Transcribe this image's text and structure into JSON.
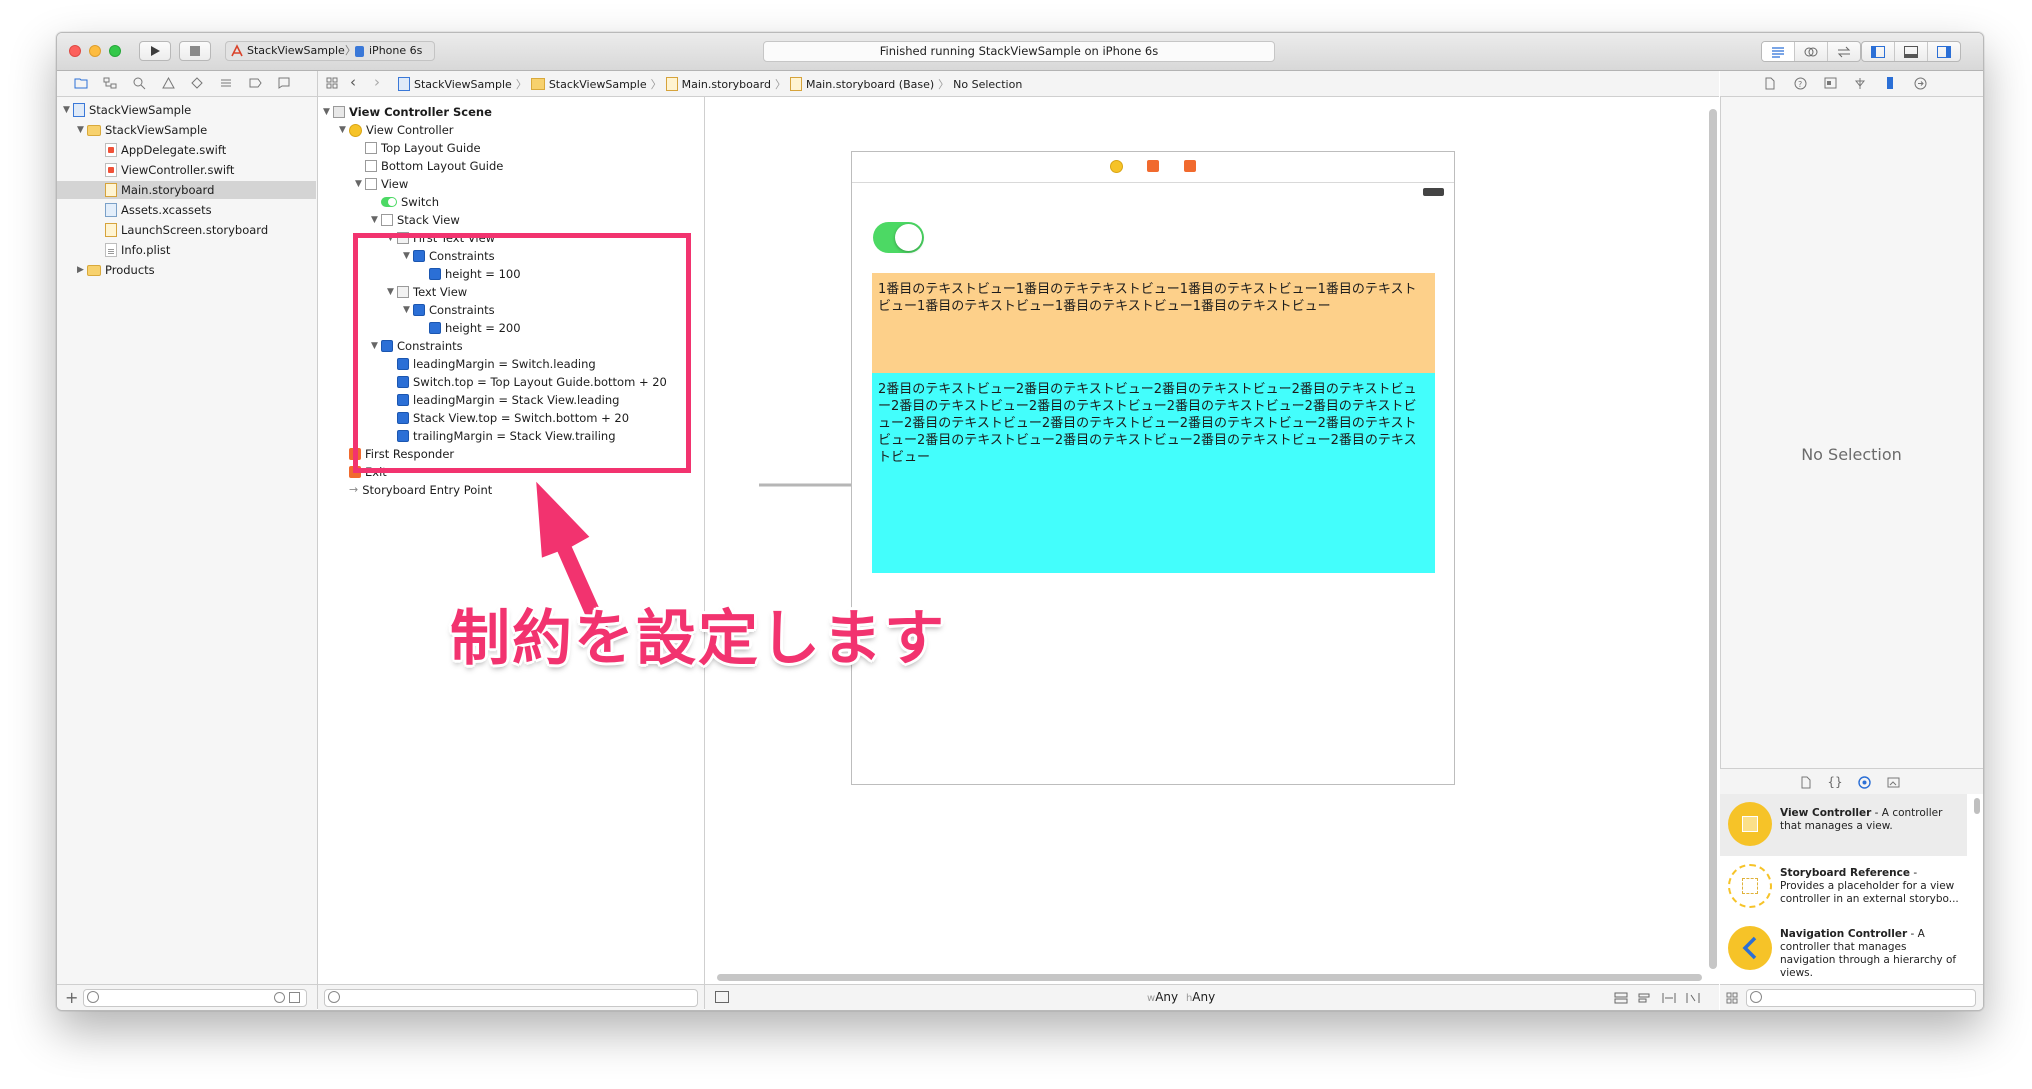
{
  "toolbar": {
    "scheme": "StackViewSample",
    "device": "iPhone 6s",
    "status": "Finished running StackViewSample on iPhone 6s",
    "colors": {
      "close": "#fc605c",
      "minimize": "#fdbc40",
      "zoom": "#34c84a"
    }
  },
  "navigator": {
    "items": [
      {
        "label": "StackViewSample"
      },
      {
        "label": "StackViewSample"
      },
      {
        "label": "AppDelegate.swift"
      },
      {
        "label": "ViewController.swift"
      },
      {
        "label": "Main.storyboard"
      },
      {
        "label": "Assets.xcassets"
      },
      {
        "label": "LaunchScreen.storyboard"
      },
      {
        "label": "Info.plist"
      },
      {
        "label": "Products"
      }
    ]
  },
  "breadcrumb": {
    "items": [
      "StackViewSample",
      "StackViewSample",
      "Main.storyboard",
      "Main.storyboard (Base)",
      "No Selection"
    ]
  },
  "outline": {
    "items": [
      {
        "label": "View Controller Scene"
      },
      {
        "label": "View Controller"
      },
      {
        "label": "Top Layout Guide"
      },
      {
        "label": "Bottom Layout Guide"
      },
      {
        "label": "View"
      },
      {
        "label": "Switch"
      },
      {
        "label": "Stack View"
      },
      {
        "label": "First Text View"
      },
      {
        "label": "Constraints"
      },
      {
        "label": "height = 100"
      },
      {
        "label": "Text View"
      },
      {
        "label": "Constraints"
      },
      {
        "label": "height = 200"
      },
      {
        "label": "Constraints"
      },
      {
        "label": "leadingMargin = Switch.leading"
      },
      {
        "label": "Switch.top = Top Layout Guide.bottom + 20"
      },
      {
        "label": "leadingMargin = Stack View.leading"
      },
      {
        "label": "Stack View.top = Switch.bottom + 20"
      },
      {
        "label": "trailingMargin = Stack View.trailing"
      },
      {
        "label": "First Responder"
      },
      {
        "label": "Exit"
      },
      {
        "label": "Storyboard Entry Point"
      }
    ]
  },
  "canvas": {
    "text1": "1番目のテキストビュー1番目のテキテキストビュー1番目のテキストビュー1番目のテキストビュー1番目のテキストビュー1番目のテキストビュー1番目のテキストビュー",
    "text2": "2番目のテキストビュー2番目のテキストビュー2番目のテキストビュー2番目のテキストビュー2番目のテキストビュー2番目のテキストビュー2番目のテキストビュー2番目のテキストビュー2番目のテキストビュー2番目のテキストビュー2番目のテキストビュー2番目のテキストビュー2番目のテキストビュー2番目のテキストビュー2番目のテキストビュー2番目のテキストビュー",
    "text1_bg": "#fdd08a",
    "text2_bg": "#43fefc",
    "size_class_w": "w",
    "size_class_w_val": "Any",
    "size_class_h": "h",
    "size_class_h_val": "Any"
  },
  "annotation": {
    "text": "制約を設定します",
    "color": "#f2336f"
  },
  "inspector": {
    "no_selection": "No Selection"
  },
  "library": {
    "items": [
      {
        "title": "View Controller",
        "desc": " - A controller that manages a view."
      },
      {
        "title": "Storyboard Reference",
        "desc": " - Provides a placeholder for a view controller in an external storybo..."
      },
      {
        "title": "Navigation Controller",
        "desc": " - A controller that manages navigation through a hierarchy of views."
      }
    ]
  }
}
